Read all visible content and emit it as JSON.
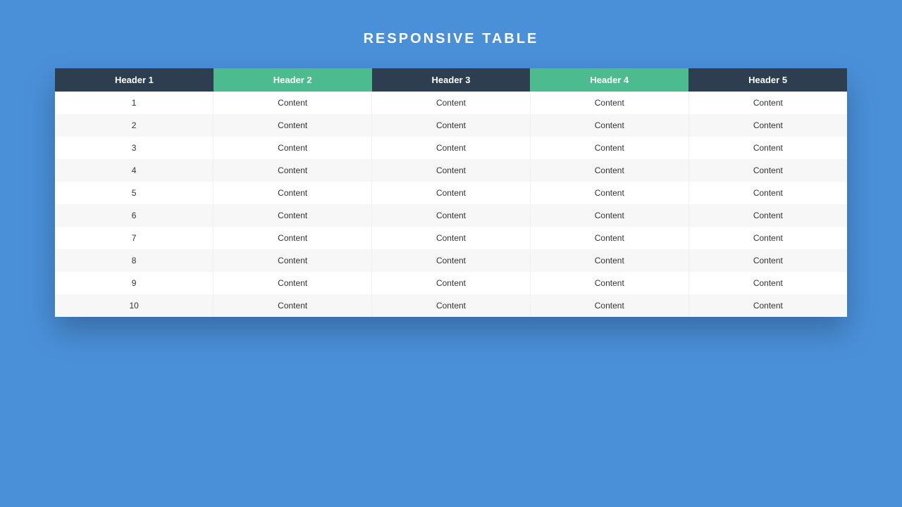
{
  "title": "RESPONSIVE TABLE",
  "headers": [
    {
      "label": "Header 1",
      "accent": false
    },
    {
      "label": "Header 2",
      "accent": true
    },
    {
      "label": "Header 3",
      "accent": false
    },
    {
      "label": "Header 4",
      "accent": true
    },
    {
      "label": "Header 5",
      "accent": false
    }
  ],
  "rows": [
    {
      "cells": [
        "1",
        "Content",
        "Content",
        "Content",
        "Content"
      ]
    },
    {
      "cells": [
        "2",
        "Content",
        "Content",
        "Content",
        "Content"
      ]
    },
    {
      "cells": [
        "3",
        "Content",
        "Content",
        "Content",
        "Content"
      ]
    },
    {
      "cells": [
        "4",
        "Content",
        "Content",
        "Content",
        "Content"
      ]
    },
    {
      "cells": [
        "5",
        "Content",
        "Content",
        "Content",
        "Content"
      ]
    },
    {
      "cells": [
        "6",
        "Content",
        "Content",
        "Content",
        "Content"
      ]
    },
    {
      "cells": [
        "7",
        "Content",
        "Content",
        "Content",
        "Content"
      ]
    },
    {
      "cells": [
        "8",
        "Content",
        "Content",
        "Content",
        "Content"
      ]
    },
    {
      "cells": [
        "9",
        "Content",
        "Content",
        "Content",
        "Content"
      ]
    },
    {
      "cells": [
        "10",
        "Content",
        "Content",
        "Content",
        "Content"
      ]
    }
  ]
}
